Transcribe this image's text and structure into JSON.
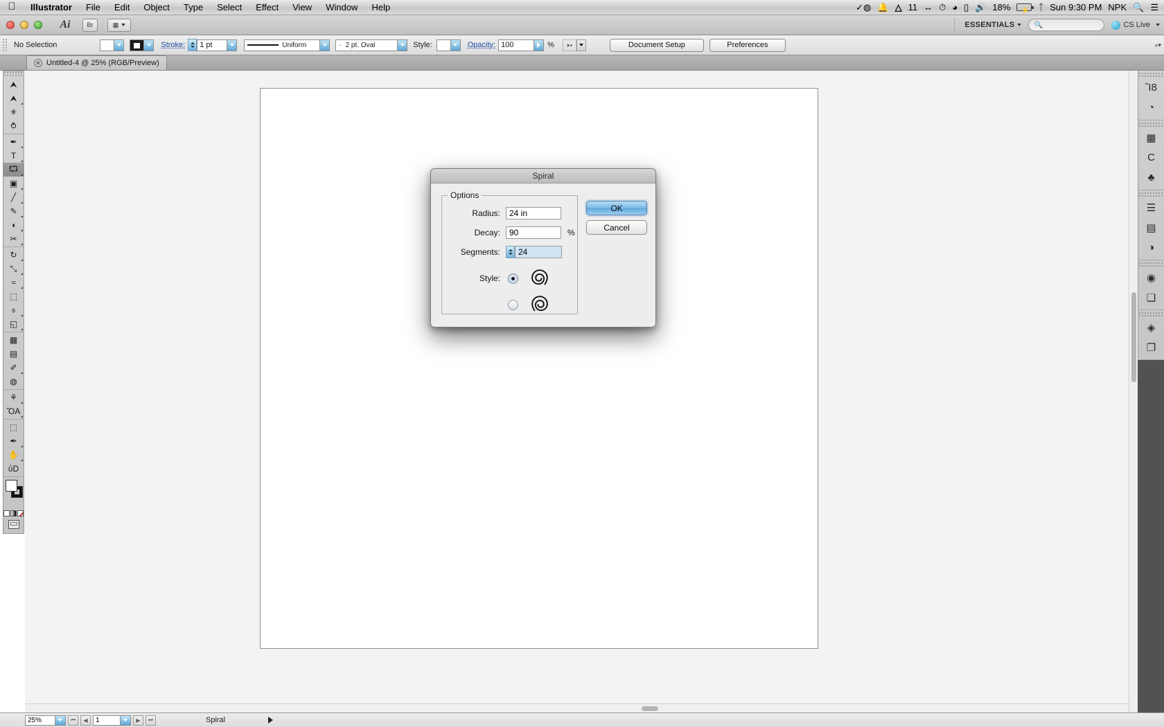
{
  "menubar": {
    "apple_icon": "apple-icon",
    "app_name": "Illustrator",
    "items": [
      "File",
      "Edit",
      "Object",
      "Type",
      "Select",
      "Effect",
      "View",
      "Window",
      "Help"
    ],
    "right": {
      "dropbox_icon": "dropbox-icon",
      "bell_icon": "bell-icon",
      "adobe_icon": "adobe-icon",
      "adobe_count": "11",
      "resolution_icon": "resolution-icon",
      "timemachine_icon": "time-machine-icon",
      "wifi_icon": "wifi-icon",
      "keyboard_icon": "keyboard-icon",
      "volume_icon": "volume-icon",
      "battery_percent": "18%",
      "battery_icon": "battery-icon",
      "bluetooth_icon": "bluetooth-icon",
      "datetime": "Sun 9:30 PM",
      "user": "NPK",
      "spotlight_icon": "search-icon",
      "notification_icon": "notification-center-icon"
    }
  },
  "appbar": {
    "logo": "Ai",
    "bridge_label": "Br",
    "arrange_label": "Arrange Documents",
    "workspace": "ESSENTIALS",
    "search_placeholder": "",
    "cslive": "CS Live"
  },
  "controlbar": {
    "selection_status": "No Selection",
    "stroke_label": "Stroke:",
    "stroke_weight": "1 pt",
    "stroke_profile": "Uniform",
    "brush_def": "2 pt. Oval",
    "style_label": "Style:",
    "opacity_label": "Opacity:",
    "opacity_value": "100",
    "percent_sign": "%",
    "document_setup": "Document Setup",
    "preferences": "Preferences"
  },
  "tabbar": {
    "document_tab": "Untitled-4 @ 25% (RGB/Preview)",
    "close_glyph": "✕"
  },
  "toolbox": {
    "groups": [
      [
        {
          "name": "selection-tool",
          "glyph": "⮝",
          "selected": false,
          "corner": false
        },
        {
          "name": "direct-selection-tool",
          "glyph": "⮝",
          "selected": false,
          "corner": true
        },
        {
          "name": "magic-wand-tool",
          "glyph": "✳",
          "selected": false,
          "corner": false
        },
        {
          "name": "lasso-tool",
          "glyph": "⥁",
          "selected": false,
          "corner": false
        }
      ],
      [
        {
          "name": "pen-tool",
          "glyph": "✒",
          "selected": false,
          "corner": true
        },
        {
          "name": "type-tool",
          "glyph": "T",
          "selected": false,
          "corner": true
        },
        {
          "name": "spiral-tool",
          "glyph": "⮔",
          "selected": true,
          "corner": true
        },
        {
          "name": "rectangle-tool",
          "glyph": "▣",
          "selected": false,
          "corner": true
        },
        {
          "name": "paintbrush-tool",
          "glyph": "╱",
          "selected": false,
          "corner": true
        },
        {
          "name": "pencil-tool",
          "glyph": "✎",
          "selected": false,
          "corner": true
        },
        {
          "name": "blob-brush-tool",
          "glyph": "◖",
          "selected": false,
          "corner": true
        },
        {
          "name": "eraser-tool",
          "glyph": "✂",
          "selected": false,
          "corner": true
        }
      ],
      [
        {
          "name": "rotate-tool",
          "glyph": "↻",
          "selected": false,
          "corner": true
        },
        {
          "name": "scale-tool",
          "glyph": "⤡",
          "selected": false,
          "corner": true
        },
        {
          "name": "width-tool",
          "glyph": "≈",
          "selected": false,
          "corner": true
        },
        {
          "name": "free-transform-tool",
          "glyph": "⬚",
          "selected": false,
          "corner": false
        },
        {
          "name": "shape-builder-tool",
          "glyph": "⌽",
          "selected": false,
          "corner": true
        },
        {
          "name": "perspective-grid-tool",
          "glyph": "◱",
          "selected": false,
          "corner": true
        }
      ],
      [
        {
          "name": "mesh-tool",
          "glyph": "▦",
          "selected": false,
          "corner": false
        },
        {
          "name": "gradient-tool",
          "glyph": "▤",
          "selected": false,
          "corner": false
        },
        {
          "name": "eyedropper-tool",
          "glyph": "✐",
          "selected": false,
          "corner": true
        },
        {
          "name": "blend-tool",
          "glyph": "◍",
          "selected": false,
          "corner": false
        }
      ],
      [
        {
          "name": "symbol-sprayer-tool",
          "glyph": "⚘",
          "selected": false,
          "corner": true
        },
        {
          "name": "column-graph-tool",
          "glyph": "ὌA",
          "selected": false,
          "corner": true
        }
      ],
      [
        {
          "name": "artboard-tool",
          "glyph": "⬚",
          "selected": false,
          "corner": false
        },
        {
          "name": "slice-tool",
          "glyph": "✒",
          "selected": false,
          "corner": true
        },
        {
          "name": "hand-tool",
          "glyph": "✋",
          "selected": false,
          "corner": true
        },
        {
          "name": "zoom-tool",
          "glyph": "ὐD",
          "selected": false,
          "corner": false
        }
      ]
    ],
    "fill_label": "fill-swatch",
    "stroke_label": "stroke-swatch",
    "color_modes": [
      "color-swatch",
      "gradient-swatch",
      "none-swatch"
    ],
    "screen_mode": "screen-mode-button"
  },
  "dock": {
    "groups": [
      [
        {
          "name": "color-panel-icon",
          "glyph": "Ἲ8"
        },
        {
          "name": "color-guide-panel-icon",
          "glyph": "◔"
        }
      ],
      [
        {
          "name": "swatches-panel-icon",
          "glyph": "▦"
        },
        {
          "name": "brushes-panel-icon",
          "glyph": "὘C"
        },
        {
          "name": "symbols-panel-icon",
          "glyph": "♣"
        }
      ],
      [
        {
          "name": "stroke-panel-icon",
          "glyph": "☰"
        },
        {
          "name": "gradient-panel-icon",
          "glyph": "▤"
        },
        {
          "name": "transparency-panel-icon",
          "glyph": "◑"
        }
      ],
      [
        {
          "name": "appearance-panel-icon",
          "glyph": "◉"
        },
        {
          "name": "graphic-styles-panel-icon",
          "glyph": "❑"
        }
      ],
      [
        {
          "name": "layers-panel-icon",
          "glyph": "◈"
        },
        {
          "name": "artboards-panel-icon",
          "glyph": "❐"
        }
      ]
    ]
  },
  "statusbar": {
    "zoom_level": "25%",
    "page_number": "1",
    "status_text": "Spiral",
    "first_glyph": "⏮",
    "prev_glyph": "◀",
    "next_glyph": "▶",
    "last_glyph": "⏭"
  },
  "dialog": {
    "title": "Spiral",
    "options_legend": "Options",
    "radius_label": "Radius:",
    "radius_value": "24 in",
    "decay_label": "Decay:",
    "decay_value": "90",
    "decay_unit": "%",
    "segments_label": "Segments:",
    "segments_value": "24",
    "style_label": "Style:",
    "style_selected_index": 0,
    "ok_label": "OK",
    "cancel_label": "Cancel"
  }
}
